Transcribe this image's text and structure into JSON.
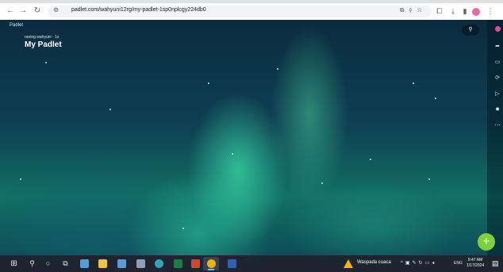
{
  "browser": {
    "url": "padlet.com/wahyuni12rg/my-padlet-1sp0nplcgy224db0",
    "nav": {
      "back": "←",
      "forward": "→",
      "reload": "↻"
    }
  },
  "padlet": {
    "brand": "Padlet",
    "owner": "raning wahyuni · 1s",
    "title": "My Padlet",
    "fab_label": "+"
  },
  "taskbar": {
    "weather_text": "Waspada cuaca",
    "language": "ENG",
    "time": "9:47 AM",
    "date": "1/17/2024"
  },
  "colors": {
    "fab": "#7bd13b",
    "avatar": "#e64a8c",
    "taskbar": "#1f2430"
  }
}
